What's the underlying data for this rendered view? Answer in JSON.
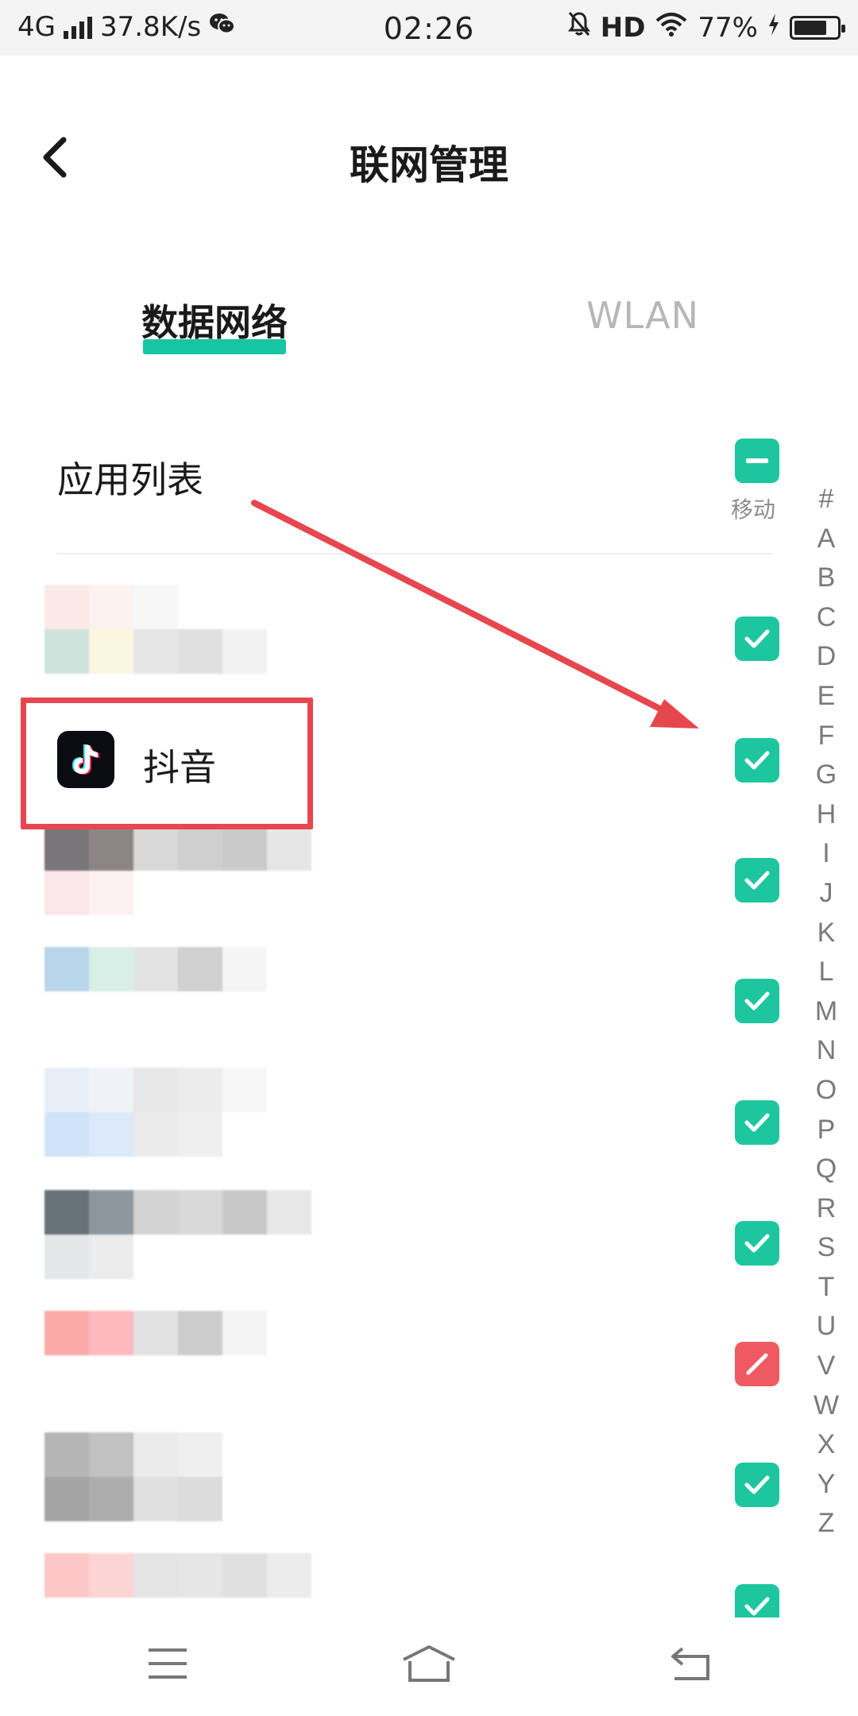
{
  "status_bar": {
    "network": "4G",
    "speed": "37.8K/s",
    "time": "02:26",
    "hd": "HD",
    "battery": "77%",
    "battery_level": 0.77
  },
  "header": {
    "title": "联网管理"
  },
  "tabs": [
    {
      "label": "数据网络",
      "active": true
    },
    {
      "label": "WLAN",
      "active": false
    }
  ],
  "list": {
    "title": "应用列表",
    "column_label": "移动",
    "column_state": "partial",
    "apps": [
      {
        "name": "",
        "blurred": true,
        "enabled": true
      },
      {
        "name": "抖音",
        "blurred": false,
        "enabled": true
      },
      {
        "name": "",
        "blurred": true,
        "enabled": true
      },
      {
        "name": "",
        "blurred": true,
        "enabled": true
      },
      {
        "name": "",
        "blurred": true,
        "enabled": true
      },
      {
        "name": "",
        "blurred": true,
        "enabled": true
      },
      {
        "name": "",
        "blurred": true,
        "enabled": false
      },
      {
        "name": "",
        "blurred": true,
        "enabled": true
      },
      {
        "name": "",
        "blurred": true,
        "enabled": true
      }
    ]
  },
  "index_letters": [
    "#",
    "A",
    "B",
    "C",
    "D",
    "E",
    "F",
    "G",
    "H",
    "I",
    "J",
    "K",
    "L",
    "M",
    "N",
    "O",
    "P",
    "Q",
    "R",
    "S",
    "T",
    "U",
    "V",
    "W",
    "X",
    "Y",
    "Z"
  ],
  "colors": {
    "accent": "#16c6a3",
    "checkbox_on": "#1ec6a0",
    "checkbox_off": "#ef5a62",
    "annotation": "#e6474f"
  },
  "icons": {
    "back": "chevron-left-icon",
    "menu": "menu-icon",
    "home": "home-icon",
    "return": "return-icon"
  }
}
